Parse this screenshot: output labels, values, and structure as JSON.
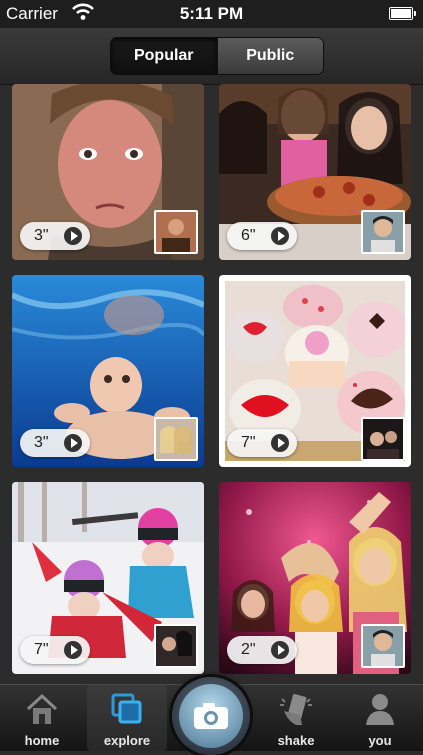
{
  "status_bar": {
    "carrier": "Carrier",
    "time": "5:11 PM"
  },
  "segmented": {
    "options": [
      {
        "label": "Popular",
        "active": true
      },
      {
        "label": "Public",
        "active": false
      }
    ]
  },
  "videos": [
    {
      "duration": "3\"",
      "scene": "selfie-man"
    },
    {
      "duration": "6\"",
      "scene": "girls-pizza"
    },
    {
      "duration": "3\"",
      "scene": "baby-underwater"
    },
    {
      "duration": "7\"",
      "scene": "cupcakes"
    },
    {
      "duration": "7\"",
      "scene": "kids-snow"
    },
    {
      "duration": "2\"",
      "scene": "party-girls"
    }
  ],
  "tab_bar": {
    "tabs": [
      {
        "label": "home",
        "icon": "house-icon"
      },
      {
        "label": "explore",
        "icon": "layers-icon",
        "active": true
      },
      {
        "label": "camera",
        "icon": "camera-icon"
      },
      {
        "label": "shake",
        "icon": "shake-phone-icon"
      },
      {
        "label": "you",
        "icon": "person-icon"
      }
    ]
  },
  "colors": {
    "background": "#2c2c2c",
    "header": "#2e2e2e",
    "camera_accent": "#6a93ad"
  }
}
